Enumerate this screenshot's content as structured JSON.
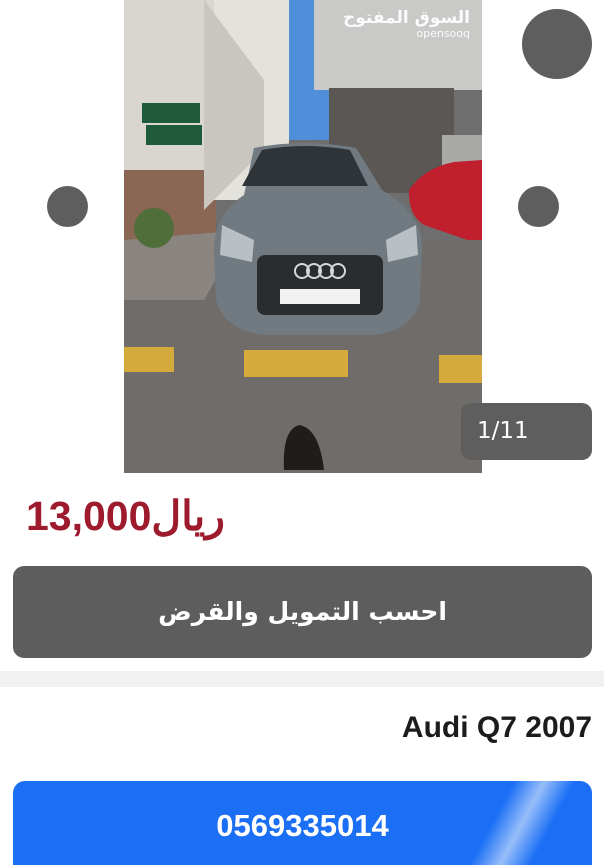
{
  "gallery": {
    "watermark_arabic": "السوق المفتوح",
    "watermark_latin": "opensooq",
    "counter": "1/11"
  },
  "listing": {
    "price_amount": "13,000",
    "price_currency": "ريال",
    "finance_button_label": "احسب التمويل والقرض",
    "title": "Audi Q7 2007",
    "phone_number": "0569335014"
  },
  "colors": {
    "price": "#9e1b2e",
    "call_button": "#1a6ff5",
    "dark_button": "#5d5d5d"
  }
}
